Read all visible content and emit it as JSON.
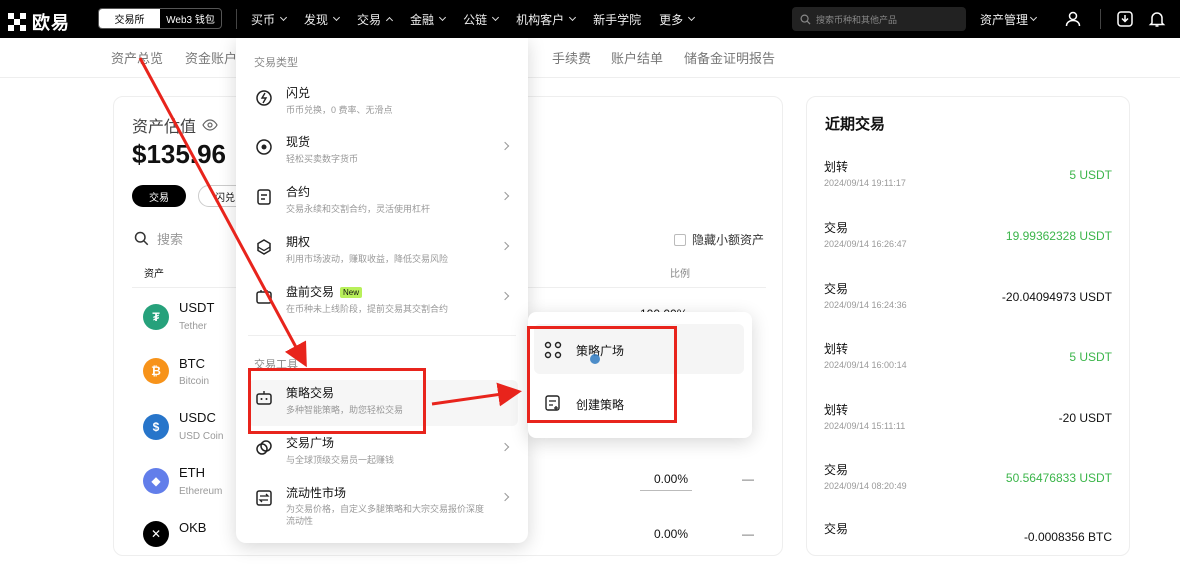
{
  "topbar": {
    "logo_text": "欧易",
    "mode_exchange": "交易所",
    "mode_web3": "Web3 钱包",
    "nav": [
      "买币",
      "发现",
      "交易",
      "金融",
      "公链",
      "机构客户",
      "新手学院",
      "更多"
    ],
    "search_placeholder": "搜索币种和其他产品",
    "asset_mgmt": "资产管理"
  },
  "subnav": [
    "资产总览",
    "资金账户",
    "手续费",
    "账户结单",
    "储备金证明报告"
  ],
  "assets": {
    "title": "资产估值",
    "value": "$135.96",
    "btn_trade": "交易",
    "btn_flash": "闪兑",
    "search_placeholder": "搜索",
    "hide_small": "隐藏小额资产",
    "col_asset": "资产",
    "col_ratio": "比例",
    "rows": [
      {
        "symbol": "USDT",
        "name": "Tether",
        "ratio": "100.00%",
        "dash": ""
      },
      {
        "symbol": "BTC",
        "name": "Bitcoin",
        "ratio": "",
        "dash": ""
      },
      {
        "symbol": "USDC",
        "name": "USD Coin",
        "ratio": "",
        "dash": ""
      },
      {
        "symbol": "ETH",
        "name": "Ethereum",
        "ratio": "0.00%",
        "dash": "—"
      },
      {
        "symbol": "OKB",
        "name": "",
        "ratio": "0.00%",
        "dash": "—"
      }
    ],
    "icon_colors": {
      "USDT": "#26a17b",
      "BTC": "#f7931a",
      "USDC": "#2775ca",
      "ETH": "#627eea",
      "OKB": "#000000"
    }
  },
  "menu": {
    "section_trade_type": "交易类型",
    "section_tools": "交易工具",
    "items": [
      {
        "title": "闪兑",
        "desc": "币币兑换，0 费率、无滑点",
        "arrow": false
      },
      {
        "title": "现货",
        "desc": "轻松买卖数字货币",
        "arrow": true
      },
      {
        "title": "合约",
        "desc": "交易永续和交割合约，灵活使用杠杆",
        "arrow": true
      },
      {
        "title": "期权",
        "desc": "利用市场波动，赚取收益，降低交易风险",
        "arrow": true
      },
      {
        "title": "盘前交易",
        "desc": "在币种未上线阶段，提前交易其交割合约",
        "arrow": true,
        "badge": "New"
      },
      {
        "title": "策略交易",
        "desc": "多种智能策略，助您轻松交易",
        "arrow": false
      },
      {
        "title": "交易广场",
        "desc": "与全球顶级交易员一起赚钱",
        "arrow": true
      },
      {
        "title": "流动性市场",
        "desc": "为交易价格，自定义多腿策略和大宗交易报价深度流动性",
        "arrow": true
      }
    ]
  },
  "submenu": {
    "items": [
      "策略广场",
      "创建策略"
    ]
  },
  "recent": {
    "title": "近期交易",
    "rows": [
      {
        "type": "划转",
        "time": "2024/09/14 19:11:17",
        "value": "5 USDT",
        "positive": true
      },
      {
        "type": "交易",
        "time": "2024/09/14 16:26:47",
        "value": "19.99362328 USDT",
        "positive": true
      },
      {
        "type": "交易",
        "time": "2024/09/14 16:24:36",
        "value": "-20.04094973 USDT",
        "positive": false
      },
      {
        "type": "划转",
        "time": "2024/09/14 16:00:14",
        "value": "5 USDT",
        "positive": true
      },
      {
        "type": "划转",
        "time": "2024/09/14 15:11:11",
        "value": "-20 USDT",
        "positive": false
      },
      {
        "type": "交易",
        "time": "2024/09/14 08:20:49",
        "value": "50.56476833 USDT",
        "positive": true
      },
      {
        "type": "交易",
        "time": "",
        "value": "-0.0008356 BTC",
        "positive": false
      }
    ]
  },
  "colors": {
    "accent_green": "#3bb54a",
    "annotation_red": "#e8241c",
    "badge_new": "#b8f05a"
  }
}
